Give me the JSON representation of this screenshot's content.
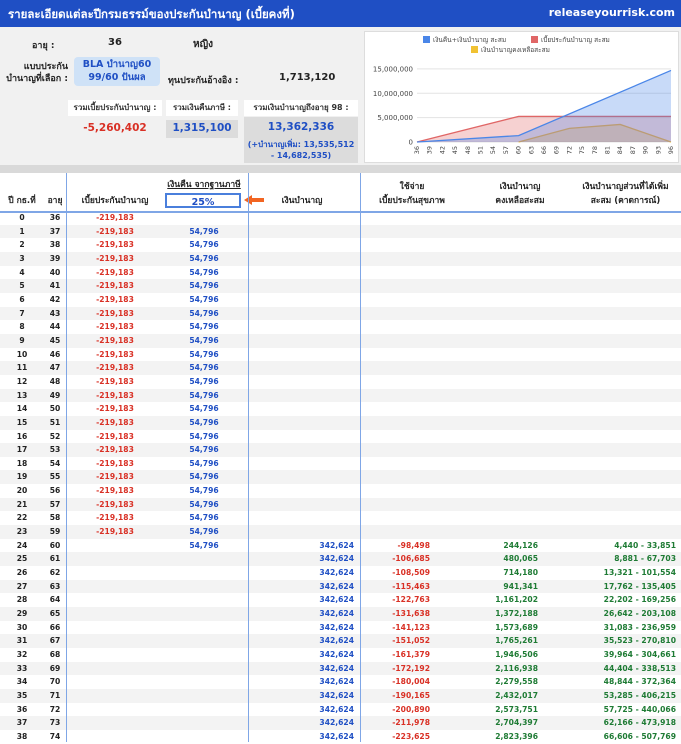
{
  "header": {
    "title": "รายละเอียดแต่ละปีกรมธรรม์ของประกันบำนาญ (เบี้ยคงที่)",
    "brand": "releaseyourrisk.com"
  },
  "summary": {
    "age_label": "อายุ :",
    "age_value": "36",
    "gender": "หญิง",
    "plan_label": "แบบประกัน บำนาญที่เลือก :",
    "plan_line1": "BLA บำนาญ60",
    "plan_line2": "99/60 ปันผล",
    "sum_label": "ทุนประกันอ้างอิง :",
    "sum_value": "1,713,120",
    "total_premium_label": "รวมเบี้ยประกันบำนาญ :",
    "total_premium_value": "-5,260,402",
    "total_refund_label": "รวมเงินคืนภาษี :",
    "total_refund_value": "1,315,100",
    "total_annuity_label": "รวมเงินบำนาญถึงอายุ 98 :",
    "total_annuity_value": "13,362,336",
    "extra_annuity": "(+บำนาญเพิ่ม: 13,535,512 - 14,682,535)"
  },
  "chart_data": {
    "type": "area",
    "legend": [
      "เงินคืน+เงินบำนาญ สะสม",
      "เบี้ยประกันบำนาญ สะสม",
      "เงินบำนาญคงเหลือสะสม"
    ],
    "colors": [
      "#4a86e8",
      "#e06666",
      "#f1c232"
    ],
    "yticks": [
      "15,000,000",
      "10,000,000",
      "5,000,000",
      "0"
    ],
    "ylim": [
      0,
      16000000
    ],
    "xticks": [
      "36",
      "39",
      "42",
      "45",
      "48",
      "51",
      "54",
      "57",
      "60",
      "63",
      "66",
      "69",
      "72",
      "75",
      "78",
      "81",
      "84",
      "87",
      "90",
      "93",
      "96"
    ],
    "series": [
      {
        "name": "เงินคืน+เงินบำนาญ สะสม",
        "x": [
          36,
          60,
          96
        ],
        "values": [
          0,
          1315100,
          14677436
        ]
      },
      {
        "name": "เบี้ยประกันบำนาญ สะสม",
        "x": [
          36,
          60,
          96
        ],
        "values": [
          0,
          5260402,
          5260402
        ]
      },
      {
        "name": "เงินบำนาญคงเหลือสะสม",
        "x": [
          60,
          72,
          84,
          96
        ],
        "values": [
          0,
          2800000,
          3600000,
          0
        ]
      }
    ]
  },
  "table": {
    "headers": {
      "year": "ปี กธ.ที่",
      "age": "อายุ",
      "premium": "เบี้ยประกันบำนาญ",
      "tax_top": "เงินคืน จากฐานภาษี",
      "annuity": "เงินบำนาญ",
      "medical_1": "ใช้จ่าย",
      "medical_2": "เบี้ยประกันสุขภาพ",
      "balance_1": "เงินบำนาญ",
      "balance_2": "คงเหลือสะสม",
      "extra_1": "เงินบำนาญส่วนที่ได้เพิ่ม",
      "extra_2": "สะสม (คาดการณ์)"
    },
    "tax_rate": "25%",
    "rows": [
      [
        "0",
        "36",
        "-219,183",
        "",
        "",
        "",
        "",
        ""
      ],
      [
        "1",
        "37",
        "-219,183",
        "54,796",
        "",
        "",
        "",
        ""
      ],
      [
        "2",
        "38",
        "-219,183",
        "54,796",
        "",
        "",
        "",
        ""
      ],
      [
        "3",
        "39",
        "-219,183",
        "54,796",
        "",
        "",
        "",
        ""
      ],
      [
        "4",
        "40",
        "-219,183",
        "54,796",
        "",
        "",
        "",
        ""
      ],
      [
        "5",
        "41",
        "-219,183",
        "54,796",
        "",
        "",
        "",
        ""
      ],
      [
        "6",
        "42",
        "-219,183",
        "54,796",
        "",
        "",
        "",
        ""
      ],
      [
        "7",
        "43",
        "-219,183",
        "54,796",
        "",
        "",
        "",
        ""
      ],
      [
        "8",
        "44",
        "-219,183",
        "54,796",
        "",
        "",
        "",
        ""
      ],
      [
        "9",
        "45",
        "-219,183",
        "54,796",
        "",
        "",
        "",
        ""
      ],
      [
        "10",
        "46",
        "-219,183",
        "54,796",
        "",
        "",
        "",
        ""
      ],
      [
        "11",
        "47",
        "-219,183",
        "54,796",
        "",
        "",
        "",
        ""
      ],
      [
        "12",
        "48",
        "-219,183",
        "54,796",
        "",
        "",
        "",
        ""
      ],
      [
        "13",
        "49",
        "-219,183",
        "54,796",
        "",
        "",
        "",
        ""
      ],
      [
        "14",
        "50",
        "-219,183",
        "54,796",
        "",
        "",
        "",
        ""
      ],
      [
        "15",
        "51",
        "-219,183",
        "54,796",
        "",
        "",
        "",
        ""
      ],
      [
        "16",
        "52",
        "-219,183",
        "54,796",
        "",
        "",
        "",
        ""
      ],
      [
        "17",
        "53",
        "-219,183",
        "54,796",
        "",
        "",
        "",
        ""
      ],
      [
        "18",
        "54",
        "-219,183",
        "54,796",
        "",
        "",
        "",
        ""
      ],
      [
        "19",
        "55",
        "-219,183",
        "54,796",
        "",
        "",
        "",
        ""
      ],
      [
        "20",
        "56",
        "-219,183",
        "54,796",
        "",
        "",
        "",
        ""
      ],
      [
        "21",
        "57",
        "-219,183",
        "54,796",
        "",
        "",
        "",
        ""
      ],
      [
        "22",
        "58",
        "-219,183",
        "54,796",
        "",
        "",
        "",
        ""
      ],
      [
        "23",
        "59",
        "-219,183",
        "54,796",
        "",
        "",
        "",
        ""
      ],
      [
        "24",
        "60",
        "",
        "54,796",
        "342,624",
        "-98,498",
        "244,126",
        "4,440 - 33,851"
      ],
      [
        "25",
        "61",
        "",
        "",
        "342,624",
        "-106,685",
        "480,065",
        "8,881 - 67,703"
      ],
      [
        "26",
        "62",
        "",
        "",
        "342,624",
        "-108,509",
        "714,180",
        "13,321 - 101,554"
      ],
      [
        "27",
        "63",
        "",
        "",
        "342,624",
        "-115,463",
        "941,341",
        "17,762 - 135,405"
      ],
      [
        "28",
        "64",
        "",
        "",
        "342,624",
        "-122,763",
        "1,161,202",
        "22,202 - 169,256"
      ],
      [
        "29",
        "65",
        "",
        "",
        "342,624",
        "-131,638",
        "1,372,188",
        "26,642 - 203,108"
      ],
      [
        "30",
        "66",
        "",
        "",
        "342,624",
        "-141,123",
        "1,573,689",
        "31,083 - 236,959"
      ],
      [
        "31",
        "67",
        "",
        "",
        "342,624",
        "-151,052",
        "1,765,261",
        "35,523 - 270,810"
      ],
      [
        "32",
        "68",
        "",
        "",
        "342,624",
        "-161,379",
        "1,946,506",
        "39,964 - 304,661"
      ],
      [
        "33",
        "69",
        "",
        "",
        "342,624",
        "-172,192",
        "2,116,938",
        "44,404 - 338,513"
      ],
      [
        "34",
        "70",
        "",
        "",
        "342,624",
        "-180,004",
        "2,279,558",
        "48,844 - 372,364"
      ],
      [
        "35",
        "71",
        "",
        "",
        "342,624",
        "-190,165",
        "2,432,017",
        "53,285 - 406,215"
      ],
      [
        "36",
        "72",
        "",
        "",
        "342,624",
        "-200,890",
        "2,573,751",
        "57,725 - 440,066"
      ],
      [
        "37",
        "73",
        "",
        "",
        "342,624",
        "-211,978",
        "2,704,397",
        "62,166 - 473,918"
      ],
      [
        "38",
        "74",
        "",
        "",
        "342,624",
        "-223,625",
        "2,823,396",
        "66,606 - 507,769"
      ]
    ]
  }
}
